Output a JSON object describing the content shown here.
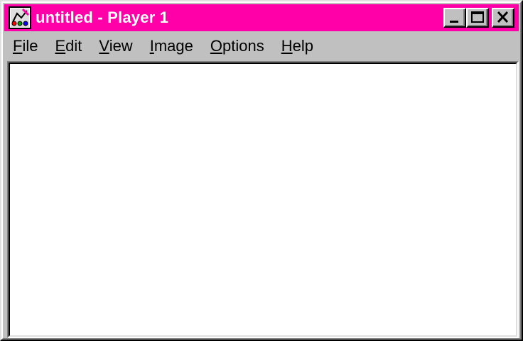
{
  "window": {
    "title": "untitled - Player 1",
    "icon": "paint-palette-icon",
    "colors": {
      "titlebar": "#ff00a8",
      "face": "#c0c0c0",
      "client": "#ffffff"
    }
  },
  "title_buttons": {
    "minimize": "minimize-icon",
    "maximize": "maximize-icon",
    "close": "close-icon"
  },
  "menu": {
    "items": [
      {
        "accel": "F",
        "rest": "ile"
      },
      {
        "accel": "E",
        "rest": "dit"
      },
      {
        "accel": "V",
        "rest": "iew"
      },
      {
        "accel": "I",
        "rest": "mage"
      },
      {
        "accel": "O",
        "rest": "ptions"
      },
      {
        "accel": "H",
        "rest": "elp"
      }
    ]
  }
}
